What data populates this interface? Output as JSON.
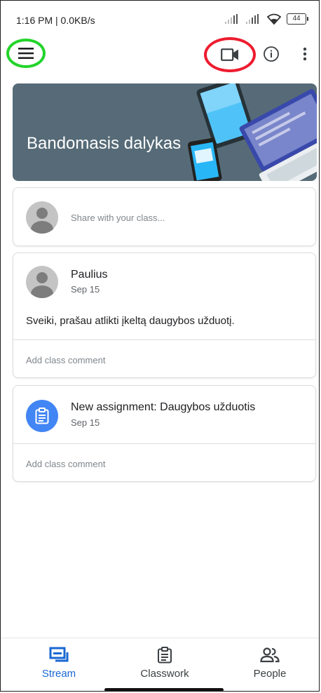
{
  "status_bar": {
    "time_speed": "1:16 PM | 0.0KB/s",
    "battery": "44"
  },
  "app_bar": {
    "icons": [
      "menu-icon",
      "video-icon",
      "info-icon",
      "more-vert-icon"
    ],
    "highlight_colors": {
      "menu": "#22d42a",
      "video": "#ee1c2f"
    }
  },
  "banner": {
    "title": "Bandomasis dalykas",
    "background": "#566b77"
  },
  "share": {
    "placeholder": "Share with your class..."
  },
  "posts": [
    {
      "author": "Paulius",
      "date": "Sep 15",
      "body": "Sveiki, prašau atlikti įkeltą daugybos užduotį.",
      "comment_prompt": "Add class comment"
    }
  ],
  "assignments": [
    {
      "title": "New assignment: Daugybos užduotis",
      "date": "Sep 15",
      "comment_prompt": "Add class comment"
    }
  ],
  "bottom_nav": {
    "items": [
      {
        "label": "Stream",
        "icon": "stream-icon",
        "active": true
      },
      {
        "label": "Classwork",
        "icon": "classwork-icon",
        "active": false
      },
      {
        "label": "People",
        "icon": "people-icon",
        "active": false
      }
    ],
    "accent": "#1967d2"
  }
}
